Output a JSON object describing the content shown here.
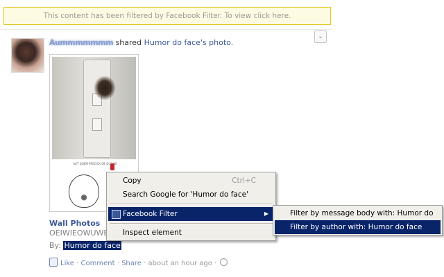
{
  "banner": {
    "text": "This content has been filtered by Facebook Filter. To view click here."
  },
  "story": {
    "author": "Aummmmmmm",
    "action_text": "shared",
    "target_link": "Humor do face's photo.",
    "dropdown_glyph": "⌄"
  },
  "photo": {
    "meme_caption": "AGT QUEM PRECISA DE GUS HE",
    "album_title": "Wall Photos",
    "album_subtitle": "OEIWIEOWUWE",
    "by_label": "By:",
    "by_name": "Humor do face"
  },
  "actions": {
    "like": "Like",
    "comment": "Comment",
    "share": "Share",
    "timestamp": "about an hour ago",
    "separator": "·"
  },
  "context_menu": {
    "items": [
      {
        "label": "Copy",
        "shortcut": "Ctrl+C"
      },
      {
        "label": "Search Google for 'Humor do face'"
      },
      {
        "label": "Facebook Filter",
        "submenu_arrow": "▶"
      },
      {
        "label": "Inspect element"
      }
    ]
  },
  "submenu": {
    "items": [
      {
        "label": "Filter by message body with: Humor do face"
      },
      {
        "label": "Filter by author with: Humor do face"
      }
    ]
  },
  "colors": {
    "link": "#3b5998",
    "selection": "#0a246a",
    "banner_bg": "#fffbe2",
    "banner_border": "#e2c822"
  }
}
